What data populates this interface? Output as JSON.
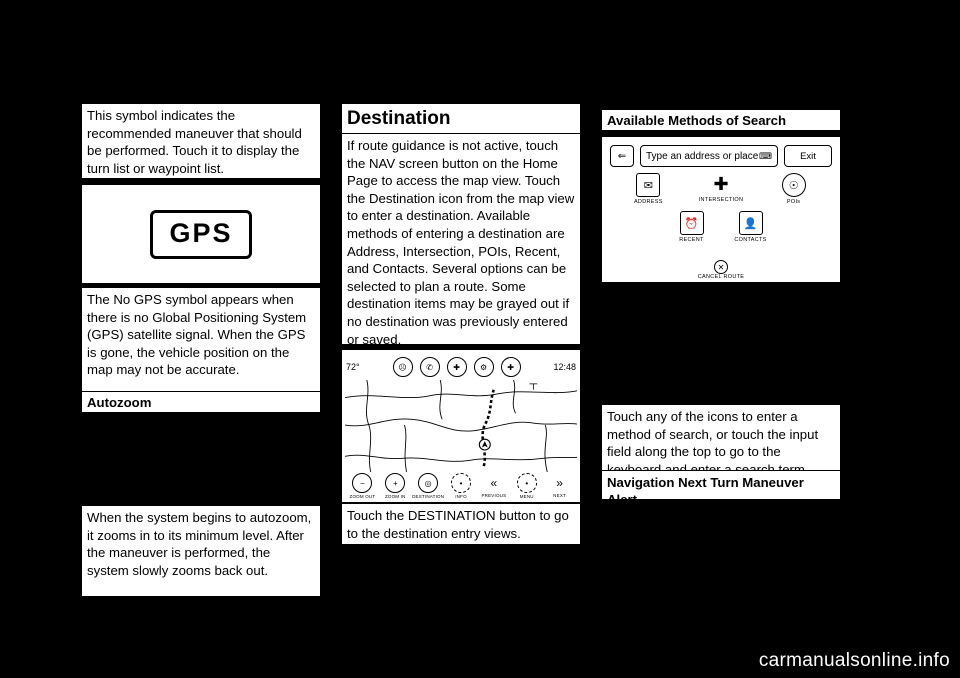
{
  "page": {
    "background": "#000000",
    "footer_text": "carmanualsonline.info"
  },
  "columns": {
    "left": {
      "intro_text": "This symbol indicates the recommended maneuver that should be performed. Touch it to display the turn list or waypoint list.",
      "gps_figure": {
        "label": "GPS",
        "name": "no-gps-symbol"
      },
      "gps_text": "The No GPS symbol appears when there is no Global Positioning System (GPS) satellite signal. When the GPS is gone, the vehicle position on the map may not be accurate.",
      "autozoom_heading": "Autozoom",
      "autozoom_text": "When the system begins to autozoom, it zooms in to its minimum level. After the maneuver is performed, the system slowly zooms back out."
    },
    "middle": {
      "section_title": "Destination",
      "destination_text": "If route guidance is not active, touch the NAV screen button on the Home Page to access the map view. Touch the Destination icon from the map view to enter a destination. Available methods of entering a destination are Address, Intersection, POIs, Recent, and Contacts. Several options can be selected to plan a route. Some destination items may be grayed out if no destination was previously entered or saved.",
      "map_screenshot": {
        "temperature": "72°",
        "clock": "12:48",
        "toolbar_icons": [
          "phone-mute-icon",
          "phone-icon",
          "compass-icon",
          "settings-icon",
          "destination-icon"
        ],
        "bottom_controls": [
          {
            "icon": "zoom-out-icon",
            "label": "ZOOM OUT"
          },
          {
            "icon": "zoom-in-icon",
            "label": "ZOOM IN"
          },
          {
            "icon": "destination-icon",
            "label": "DESTINATION"
          },
          {
            "icon": "info-icon",
            "label": "INFO"
          },
          {
            "icon": "prev-maneuver-icon",
            "label": "PREVIOUS"
          },
          {
            "icon": "menu-icon",
            "label": "MENU"
          },
          {
            "icon": "next-maneuver-icon",
            "label": "NEXT"
          }
        ]
      },
      "destination_button_text": "Touch the DESTINATION button to go to the destination entry views."
    },
    "right": {
      "methods_heading": "Available Methods of Search",
      "search_screenshot": {
        "input_placeholder": "Type an address or place",
        "keyboard_icon": "keyboard-icon",
        "back_icon": "back-arrow-icon",
        "exit_label": "Exit",
        "methods_row1": [
          {
            "icon": "address-icon",
            "label": "ADDRESS"
          },
          {
            "icon": "intersection-icon",
            "label": "INTERSECTION"
          },
          {
            "icon": "poi-icon",
            "label": "POIs"
          }
        ],
        "methods_row2": [
          {
            "icon": "recent-icon",
            "label": "RECENT"
          },
          {
            "icon": "contacts-icon",
            "label": "CONTACTS"
          }
        ],
        "cancel": {
          "icon": "cancel-icon",
          "label": "CANCEL ROUTE"
        }
      },
      "methods_text": "Touch any of the icons to enter a method of search, or touch the input field along the top to go to the keyboard and enter a search term.",
      "next_turn_heading": "Navigation Next Turn Maneuver Alert"
    }
  }
}
